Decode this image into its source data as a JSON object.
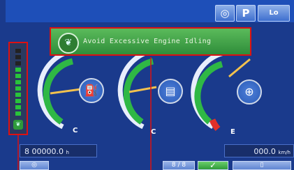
{
  "topbar": {
    "icons": [
      {
        "name": "fuel-drop-icon",
        "glyph": "◎"
      },
      {
        "name": "parking-icon",
        "glyph": "P"
      },
      {
        "name": "low-speed-icon",
        "glyph": "Lo"
      }
    ]
  },
  "notification": {
    "message": "Avoid Excessive Engine Idling",
    "icon": "leaf-eco-icon"
  },
  "gauges": [
    {
      "name": "engine-oil-temp-gauge",
      "icon": "oil-temp-icon",
      "low_label": "C"
    },
    {
      "name": "transmission-temp-gauge",
      "icon": "transmission-temp-icon",
      "low_label": "C"
    },
    {
      "name": "fuel-gauge",
      "icon": "fuel-icon",
      "low_label": "E"
    }
  ],
  "eco_meter": {
    "segments_total": 11,
    "segments_lit": 8,
    "icon": "eco-leaf-icon"
  },
  "odometer": {
    "prefix": "8",
    "value": "00000.0",
    "unit": "h"
  },
  "hourmeter": {
    "value": "000.0",
    "unit": "km/h"
  },
  "bottom_buttons": [
    {
      "name": "camera-button",
      "label": "◎"
    },
    {
      "name": "function-button",
      "label": "8 / 8"
    },
    {
      "name": "confirm-button",
      "label": "✓"
    },
    {
      "name": "menu-button",
      "label": "▯"
    }
  ],
  "colors": {
    "background": "#1a3a8c",
    "topbar": "#1e4fb8",
    "banner_green": "#3a9a43",
    "highlight_red": "#dd1111",
    "needle": "#f2c14e"
  }
}
